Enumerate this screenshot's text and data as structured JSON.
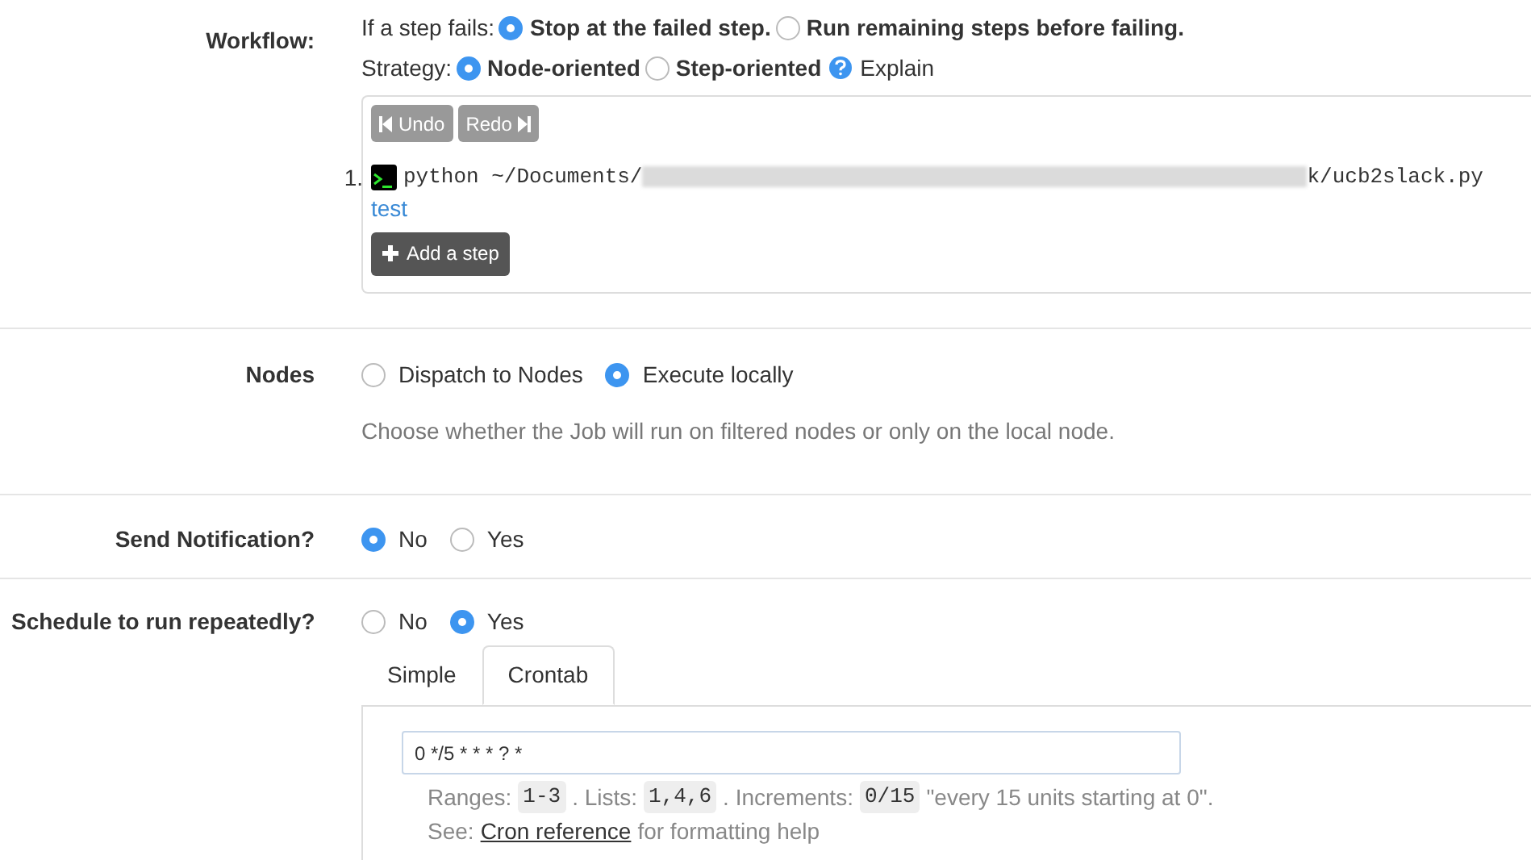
{
  "workflow": {
    "label": "Workflow:",
    "on_fail": {
      "prompt": "If a step fails:",
      "options": [
        {
          "label": "Stop at the failed step.",
          "selected": true
        },
        {
          "label": "Run remaining steps before failing.",
          "selected": false
        }
      ]
    },
    "strategy": {
      "prompt": "Strategy:",
      "options": [
        {
          "label": "Node-oriented",
          "selected": true
        },
        {
          "label": "Step-oriented",
          "selected": false
        }
      ],
      "help": "Explain"
    },
    "undo": "Undo",
    "redo": "Redo",
    "steps": [
      {
        "number": "1.",
        "command_start": "python ~/Documents/",
        "command_end": "k/ucb2slack.py",
        "description": "test"
      }
    ],
    "add_step": "Add a step"
  },
  "nodes": {
    "label": "Nodes",
    "options": [
      {
        "label": "Dispatch to Nodes",
        "selected": false
      },
      {
        "label": "Execute locally",
        "selected": true
      }
    ],
    "help": "Choose whether the Job will run on filtered nodes or only on the local node."
  },
  "notification": {
    "label": "Send Notification?",
    "options": [
      {
        "label": "No",
        "selected": true
      },
      {
        "label": "Yes",
        "selected": false
      }
    ]
  },
  "schedule": {
    "label": "Schedule to run repeatedly?",
    "options": [
      {
        "label": "No",
        "selected": false
      },
      {
        "label": "Yes",
        "selected": true
      }
    ],
    "tabs": [
      {
        "label": "Simple",
        "selected": false
      },
      {
        "label": "Crontab",
        "selected": true
      }
    ],
    "crontab": "0 */5 * * * ? *",
    "help_parts": [
      {
        "kind": "text",
        "text": "Ranges:"
      },
      {
        "kind": "code",
        "text": "1-3"
      },
      {
        "kind": "text",
        "text": ". Lists:"
      },
      {
        "kind": "code",
        "text": "1,4,6"
      },
      {
        "kind": "text",
        "text": ". Increments:"
      },
      {
        "kind": "code",
        "text": "0/15"
      },
      {
        "kind": "text",
        "text": "\"every 15 units starting at 0\"."
      }
    ],
    "see_parts": [
      {
        "kind": "text",
        "text": "See:"
      },
      {
        "kind": "link",
        "text": "Cron reference"
      },
      {
        "kind": "text",
        "text": "for formatting help"
      }
    ]
  }
}
